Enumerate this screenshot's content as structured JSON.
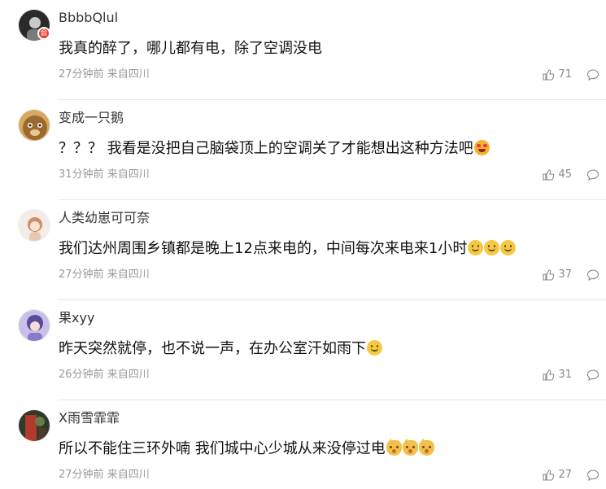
{
  "comments": [
    {
      "username": "BbbbQlul",
      "text": "我真的醉了，哪儿都有电，除了空调没电",
      "emojis": [],
      "time": "27分钟前",
      "location": "来自四川",
      "likes": "71",
      "avatar_colors": [
        "#2a2a2a",
        "#c9c9c9"
      ],
      "badge": "会"
    },
    {
      "username": "变成一只鹅",
      "text": "？？？ 我看是没把自己脑袋顶上的空调关了才能想出这种方法吧",
      "emojis": [
        "love"
      ],
      "time": "31分钟前",
      "location": "来自四川",
      "likes": "45",
      "avatar_colors": [
        "#9a6a2e",
        "#d8a860"
      ]
    },
    {
      "username": "人类幼崽可可奈",
      "text": "我们达州周围乡镇都是晚上12点来电的，中间每次来电来1小时",
      "emojis": [
        "smile",
        "smile",
        "smile"
      ],
      "time": "27分钟前",
      "location": "来自四川",
      "likes": "37",
      "avatar_colors": [
        "#f3ece6",
        "#c98f6a"
      ]
    },
    {
      "username": "果xyy",
      "text": "昨天突然就停，也不说一声，在办公室汗如雨下",
      "emojis": [
        "smile"
      ],
      "time": "26分钟前",
      "location": "来自四川",
      "likes": "31",
      "avatar_colors": [
        "#c8c0e8",
        "#5a4a9a"
      ]
    },
    {
      "username": "X雨雪霏霏",
      "text": "所以不能住三环外喃 我们城中心少城从来没停过电",
      "emojis": [
        "cat",
        "cat",
        "cat"
      ],
      "time": "27分钟前",
      "location": "来自四川",
      "likes": "27",
      "avatar_colors": [
        "#2e3a2a",
        "#b23a2a"
      ]
    }
  ],
  "icons": {
    "like": "thumbs-up-icon",
    "reply": "comment-bubble-icon"
  },
  "colors": {
    "meta": "#999999",
    "text": "#111111",
    "badge": "#e8412c"
  }
}
